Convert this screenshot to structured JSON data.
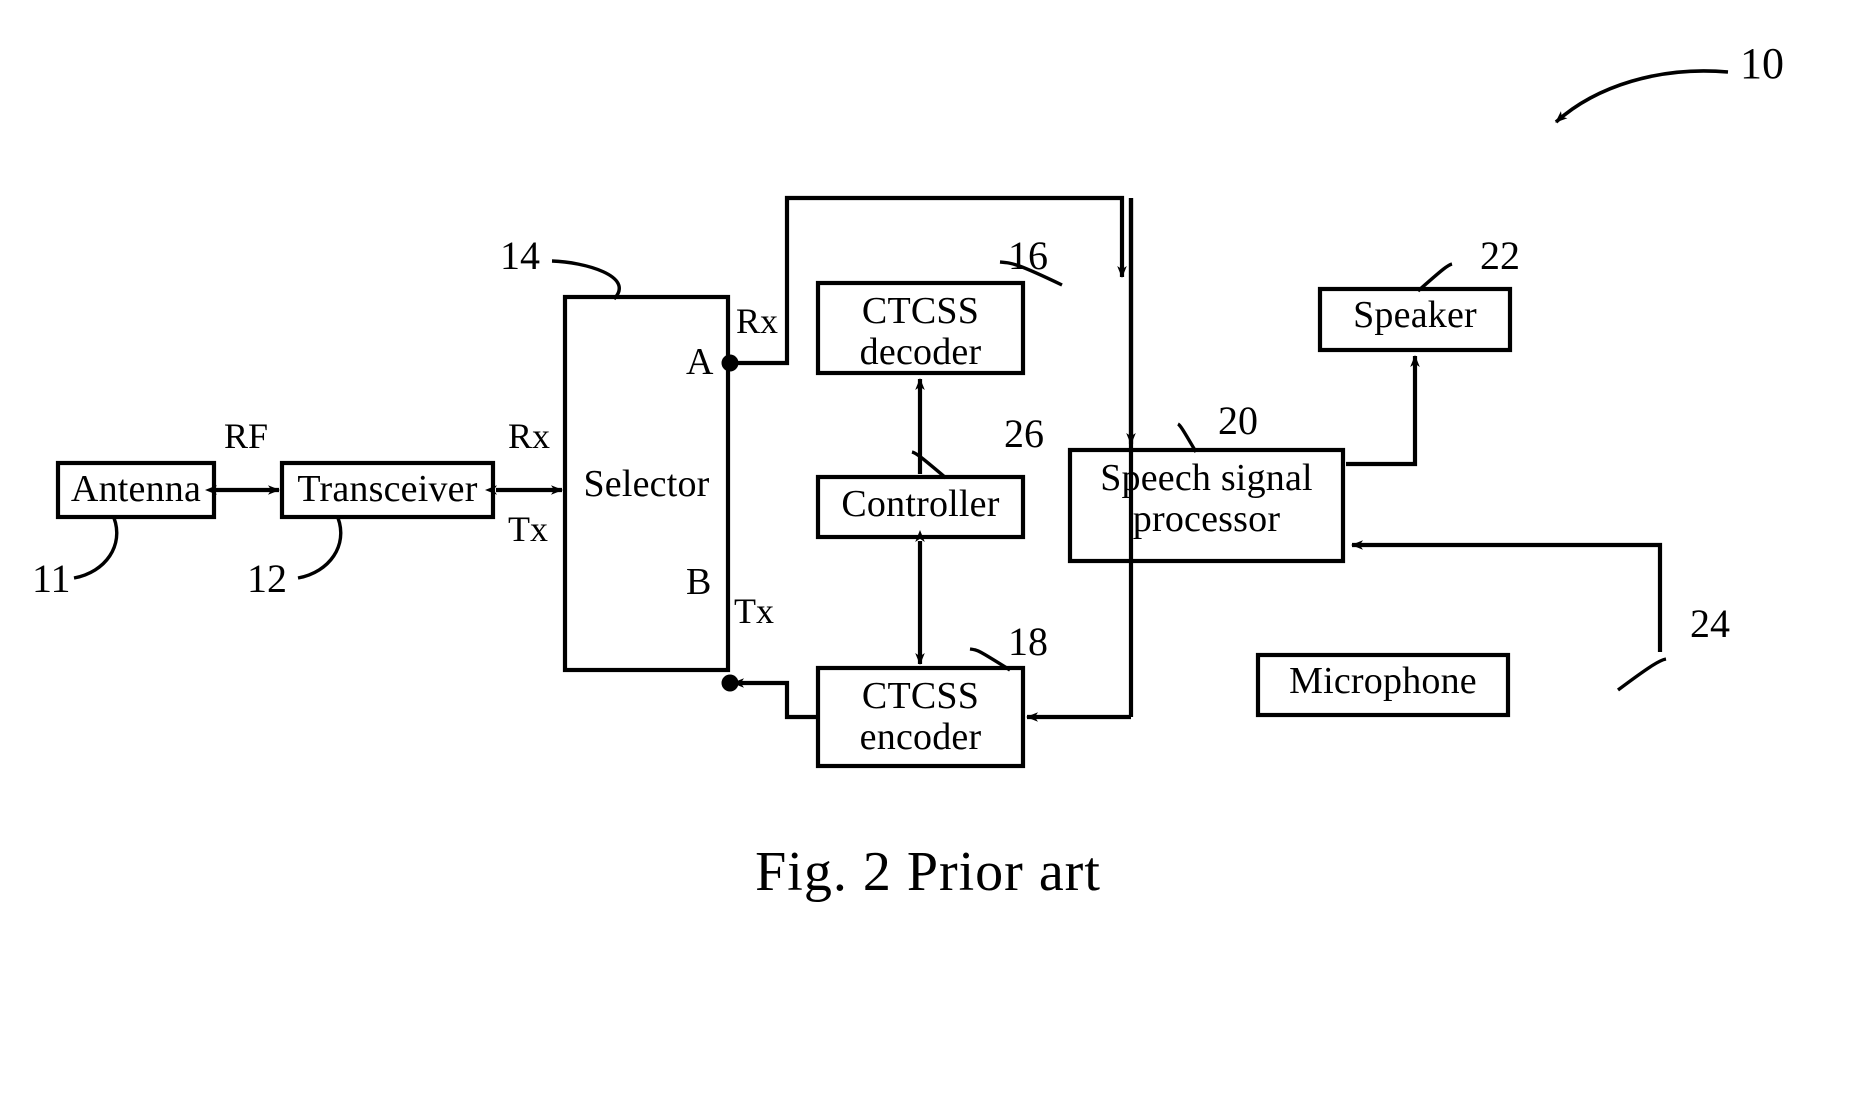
{
  "figure": {
    "caption": "Fig. 2 Prior art",
    "system_ref": "10"
  },
  "blocks": [
    {
      "id": "antenna",
      "label": "Antenna",
      "ref": "11"
    },
    {
      "id": "transceiver",
      "label": "Transceiver",
      "ref": "12"
    },
    {
      "id": "selector",
      "label": "Selector",
      "ref": "14"
    },
    {
      "id": "decoder",
      "label": "CTCSS\ndecoder",
      "ref": "16"
    },
    {
      "id": "encoder",
      "label": "CTCSS\nencoder",
      "ref": "18"
    },
    {
      "id": "controller",
      "label": "Controller",
      "ref": "26"
    },
    {
      "id": "dsp",
      "label": "Speech signal\nprocessor",
      "ref": "20"
    },
    {
      "id": "speaker",
      "label": "Speaker",
      "ref": "22"
    },
    {
      "id": "microphone",
      "label": "Microphone",
      "ref": "24"
    }
  ],
  "signal_labels": {
    "rf": "RF",
    "rx_left": "Rx",
    "tx_left": "Tx",
    "rx_right": "Rx",
    "tx_right": "Tx"
  },
  "terminals": {
    "a": "A",
    "b": "B"
  },
  "refs": {
    "antenna": "11",
    "transceiver": "12",
    "selector": "14",
    "decoder": "16",
    "encoder": "18",
    "dsp": "20",
    "speaker": "22",
    "microphone": "24",
    "controller": "26",
    "system": "10"
  },
  "colors": {
    "ink": "#000000",
    "paper": "#ffffff"
  }
}
